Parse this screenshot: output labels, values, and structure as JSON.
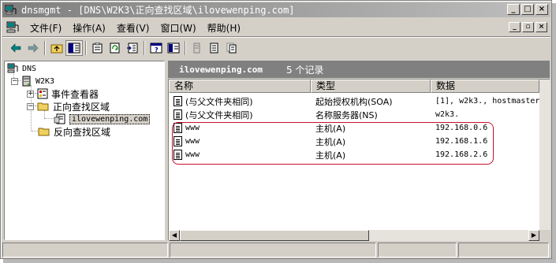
{
  "window": {
    "title": "dnsmgmt - [DNS\\W2K3\\正向查找区域\\ilovewenping.com]",
    "controls": {
      "minimize": "_",
      "maximize": "□",
      "close": "×"
    },
    "child_controls": {
      "minimize": "_",
      "restore": "▫",
      "close": "×"
    }
  },
  "menu": {
    "items": [
      "文件(F)",
      "操作(A)",
      "查看(V)",
      "窗口(W)",
      "帮助(H)"
    ]
  },
  "toolbar": {
    "buttons": [
      "back-icon",
      "forward-icon",
      "up-folder-icon",
      "show-tree-icon",
      "properties-icon",
      "refresh-icon",
      "export-list-icon",
      "help-icon",
      "console-tree-icon",
      "server-record-icon",
      "new-record-icon",
      "new-other-icon"
    ]
  },
  "tree": {
    "root": "DNS",
    "server": "W2K3",
    "event_viewer": "事件查看器",
    "forward_zones": "正向查找区域",
    "zone": "ilovewenping.com",
    "reverse_zones": "反向查找区域"
  },
  "detail": {
    "zone_name": "ilovewenping.com",
    "record_count": "5 个记录",
    "columns": [
      "名称",
      "类型",
      "数据"
    ],
    "rows": [
      {
        "name": "(与父文件夹相同)",
        "type": "起始授权机构(SOA)",
        "data": "[1], w2k3., hostmaster."
      },
      {
        "name": "(与父文件夹相同)",
        "type": "名称服务器(NS)",
        "data": "w2k3."
      },
      {
        "name": "www",
        "type": "主机(A)",
        "data": "192.168.0.6"
      },
      {
        "name": "www",
        "type": "主机(A)",
        "data": "192.168.1.6"
      },
      {
        "name": "www",
        "type": "主机(A)",
        "data": "192.168.2.6"
      }
    ]
  },
  "colors": {
    "highlight_outline": "#c8102e",
    "header_band": "#808080",
    "window_face": "#d4d0c8"
  }
}
